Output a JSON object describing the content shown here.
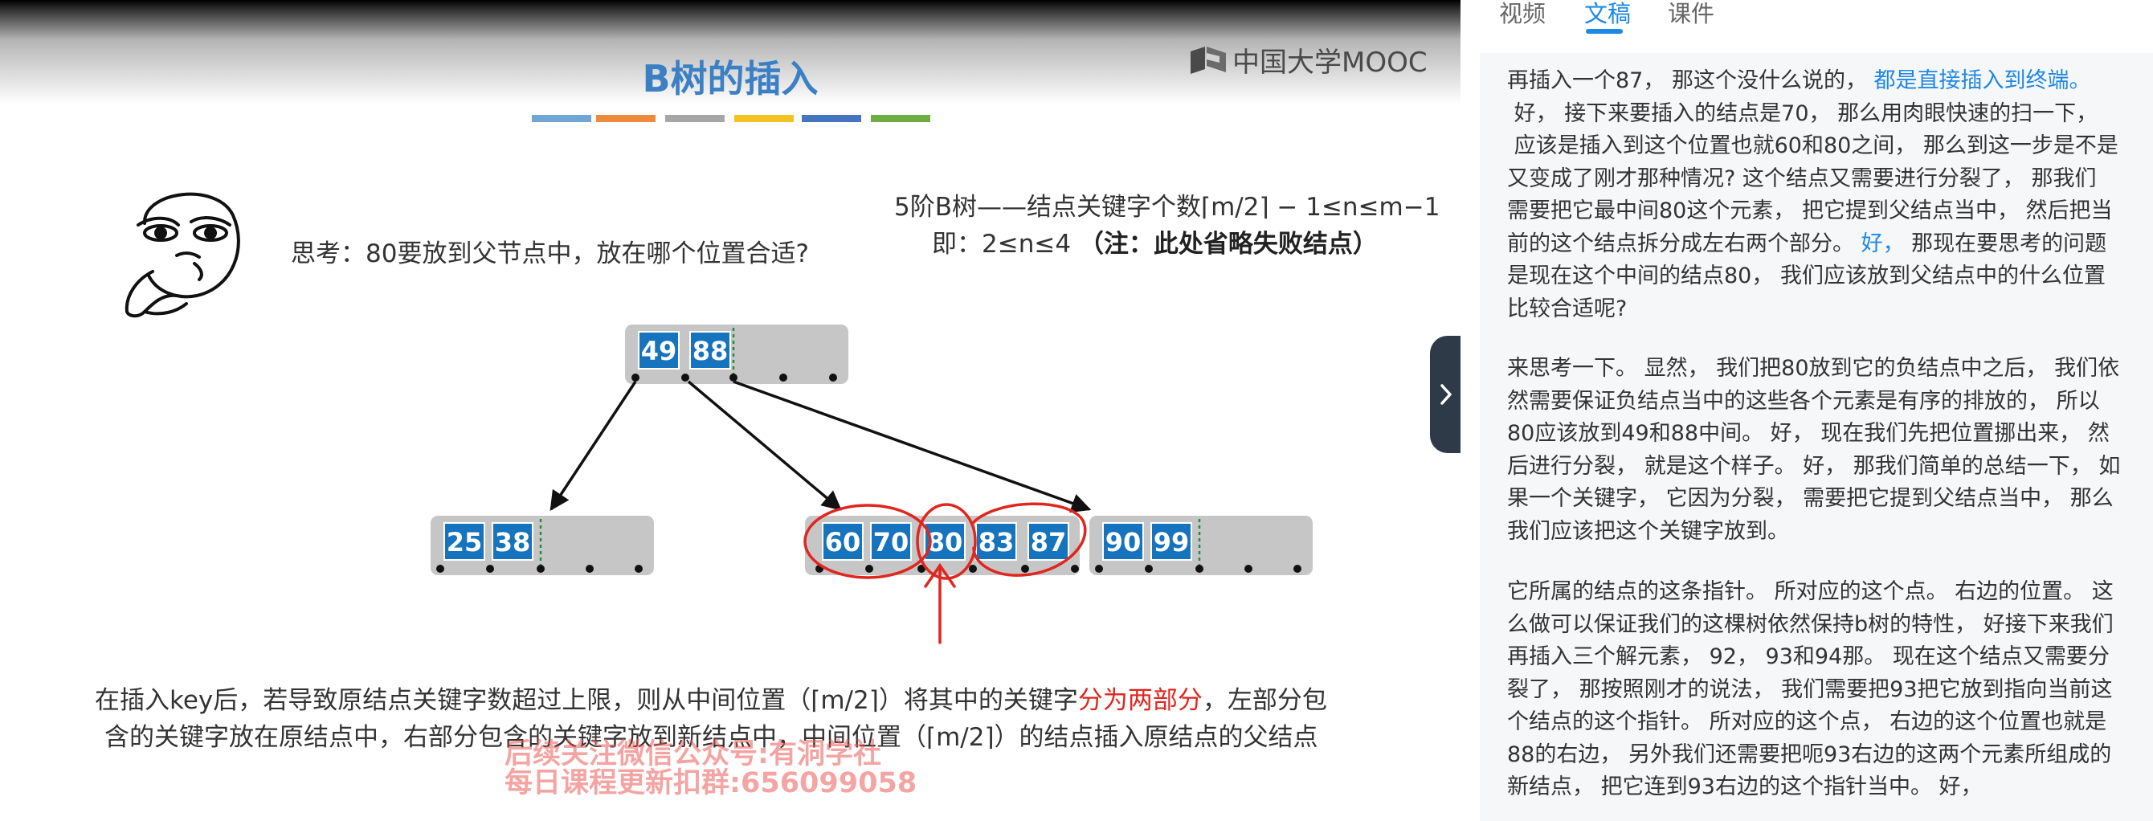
{
  "slide": {
    "title": "B树的插入",
    "logo_text": "中国大学MOOC",
    "title_bar_colors": [
      "#6fa6d6",
      "#ee8a3c",
      "#a6a6a6",
      "#f3c223",
      "#4675c0",
      "#70ad47"
    ],
    "thought_text": "思考：80要放到父节点中，放在哪个位置合适?",
    "rule_line1": "5阶B树——结点关键字个数⌈m/2⌉ − 1≤n≤m−1",
    "rule_line2_prefix": "即：2≤n≤4",
    "rule_line2_note": "（注：此处省略失败结点）",
    "tree": {
      "root_keys": [
        "49",
        "88"
      ],
      "left_keys": [
        "25",
        "38"
      ],
      "middle_keys": [
        "60",
        "70",
        "80",
        "83",
        "87"
      ],
      "right_keys": [
        "90",
        "99"
      ]
    },
    "para_part1": "在插入key后，若导致原结点关键字数超过上限，则从中间位置（⌈m/2⌉）将其中的关键字",
    "para_highlight": "分为两部分",
    "para_part2": "，左部分包",
    "para_line2": "含的关键字放在原结点中，右部分包含的关键字放到新结点中，中间位置（⌈m/2⌉）的结点插入原结点的父结点",
    "watermark_line1": "后续关注微信公众号:有洞学社",
    "watermark_line2": "每日课程更新扣群:656099058",
    "colors": {
      "title": "#3b80c4",
      "key_box": "#1673bd",
      "node_bg": "#c6c6c6",
      "annotation": "#e0261e"
    }
  },
  "panel": {
    "tabs": [
      "视频",
      "文稿",
      "课件"
    ],
    "active_tab": "文稿",
    "accent_color": "#1e88e5",
    "paragraphs": [
      {
        "lines": [
          [
            {
              "t": "再插入一个87， 那这个没什么说的， "
            },
            {
              "t": "都是直接插入到终端。",
              "hl": true
            }
          ],
          [
            {
              "t": " 好， 接下来要插入的结点是70， 那么用肉眼快速的扫一下，"
            }
          ],
          [
            {
              "t": " 应该是插入到这个位置也就60和80之间， 那么到这一步是不是"
            }
          ],
          [
            {
              "t": "又变成了刚才那种情况? 这个结点又需要进行分裂了， 那我们"
            }
          ],
          [
            {
              "t": "需要把它最中间80这个元素， 把它提到父结点当中， 然后把当"
            }
          ],
          [
            {
              "t": "前的这个结点拆分成左右两个部分。 "
            },
            {
              "t": "好，",
              "hl": true
            },
            {
              "t": " 那现在要思考的问题"
            }
          ],
          [
            {
              "t": "是现在这个中间的结点80， 我们应该放到父结点中的什么位置"
            }
          ],
          [
            {
              "t": "比较合适呢?"
            }
          ]
        ]
      },
      {
        "lines": [
          [
            {
              "t": "来思考一下。 显然， 我们把80放到它的负结点中之后， 我们依"
            }
          ],
          [
            {
              "t": "然需要保证负结点当中的这些各个元素是有序的排放的， 所以"
            }
          ],
          [
            {
              "t": "80应该放到49和88中间。 好， 现在我们先把位置挪出来， 然"
            }
          ],
          [
            {
              "t": "后进行分裂， 就是这个样子。 好， 那我们简单的总结一下， 如"
            }
          ],
          [
            {
              "t": "果一个关键字， 它因为分裂， 需要把它提到父结点当中， 那么"
            }
          ],
          [
            {
              "t": "我们应该把这个关键字放到。"
            }
          ]
        ]
      },
      {
        "lines": [
          [
            {
              "t": "它所属的结点的这条指针。 所对应的这个点。 右边的位置。 这"
            }
          ],
          [
            {
              "t": "么做可以保证我们的这棵树依然保持b树的特性， 好接下来我们"
            }
          ],
          [
            {
              "t": "再插入三个解元素， 92， 93和94那。 现在这个结点又需要分"
            }
          ],
          [
            {
              "t": "裂了， 那按照刚才的说法， 我们需要把93把它放到指向当前这"
            }
          ],
          [
            {
              "t": "个结点的这个指针。 所对应的这个点， 右边的这个位置也就是"
            }
          ],
          [
            {
              "t": "88的右边， 另外我们还需要把呃93右边的这两个元素所组成的"
            }
          ],
          [
            {
              "t": "新结点， 把它连到93右边的这个指针当中。 好，"
            }
          ]
        ]
      }
    ]
  }
}
